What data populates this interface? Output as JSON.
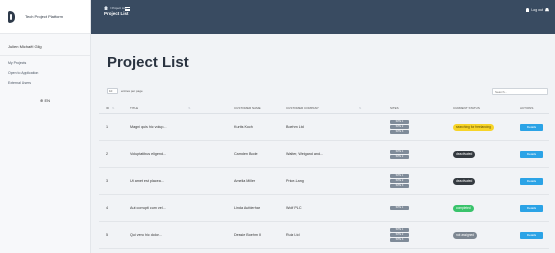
{
  "sidebar": {
    "brand": "Tech Project Platform",
    "user": "Julien Michaël Gilg",
    "links": [
      "My Projects",
      "Open to Application",
      "External Users"
    ],
    "language": "⊕ EN"
  },
  "topbar": {
    "breadcrumb": "/ Project List",
    "title": "Project List",
    "logout": "Log out"
  },
  "main": {
    "title": "Project List",
    "entries_value": "10",
    "entries_label": "entries per page",
    "search_placeholder": "Search..."
  },
  "table": {
    "headers": [
      "ID",
      "TITLE",
      "CUSTOMER NAME",
      "CUSTOMER COMPANY",
      "SITES",
      "CURRENT STATUS",
      "ACTIONS"
    ],
    "rows": [
      {
        "id": "1",
        "title": "Magni quis hic volup...",
        "customer": "Kurtis Koch",
        "company": "Boehm Ltd",
        "sites": [
          "SITE 1",
          "SITE 2",
          "SITE 3"
        ],
        "status": "searching for freelancing",
        "status_color": "#f7d428",
        "status_text_color": "#5a4a00"
      },
      {
        "id": "2",
        "title": "Voluptatibus eligend...",
        "customer": "Camden Bode",
        "company": "Walter, Weigand and...",
        "sites": [
          "SITE 1",
          "SITE 2"
        ],
        "status": "deactivated",
        "status_color": "#343a40",
        "status_text_color": "#ffffff"
      },
      {
        "id": "3",
        "title": "Ut amet est placea...",
        "customer": "Amelia Miller",
        "company": "Price-Lang",
        "sites": [
          "SITE 1",
          "SITE 2",
          "SITE 3"
        ],
        "status": "deactivated",
        "status_color": "#343a40",
        "status_text_color": "#ffffff"
      },
      {
        "id": "4",
        "title": "Aut corrupti cum vel...",
        "customer": "Linda Aufderhar",
        "company": "Wolf PLC",
        "sites": [
          "SITE 1"
        ],
        "status": "completed",
        "status_color": "#39c36b",
        "status_text_color": "#ffffff"
      },
      {
        "id": "5",
        "title": "Qui vero hic dolor...",
        "customer": "Dessie Boehm II",
        "company": "Ruiz Ltd",
        "sites": [
          "SITE 1",
          "SITE 2",
          "SITE 3"
        ],
        "status": "not assigned",
        "status_color": "#7d8792",
        "status_text_color": "#ffffff"
      }
    ],
    "action_label": "Details"
  }
}
